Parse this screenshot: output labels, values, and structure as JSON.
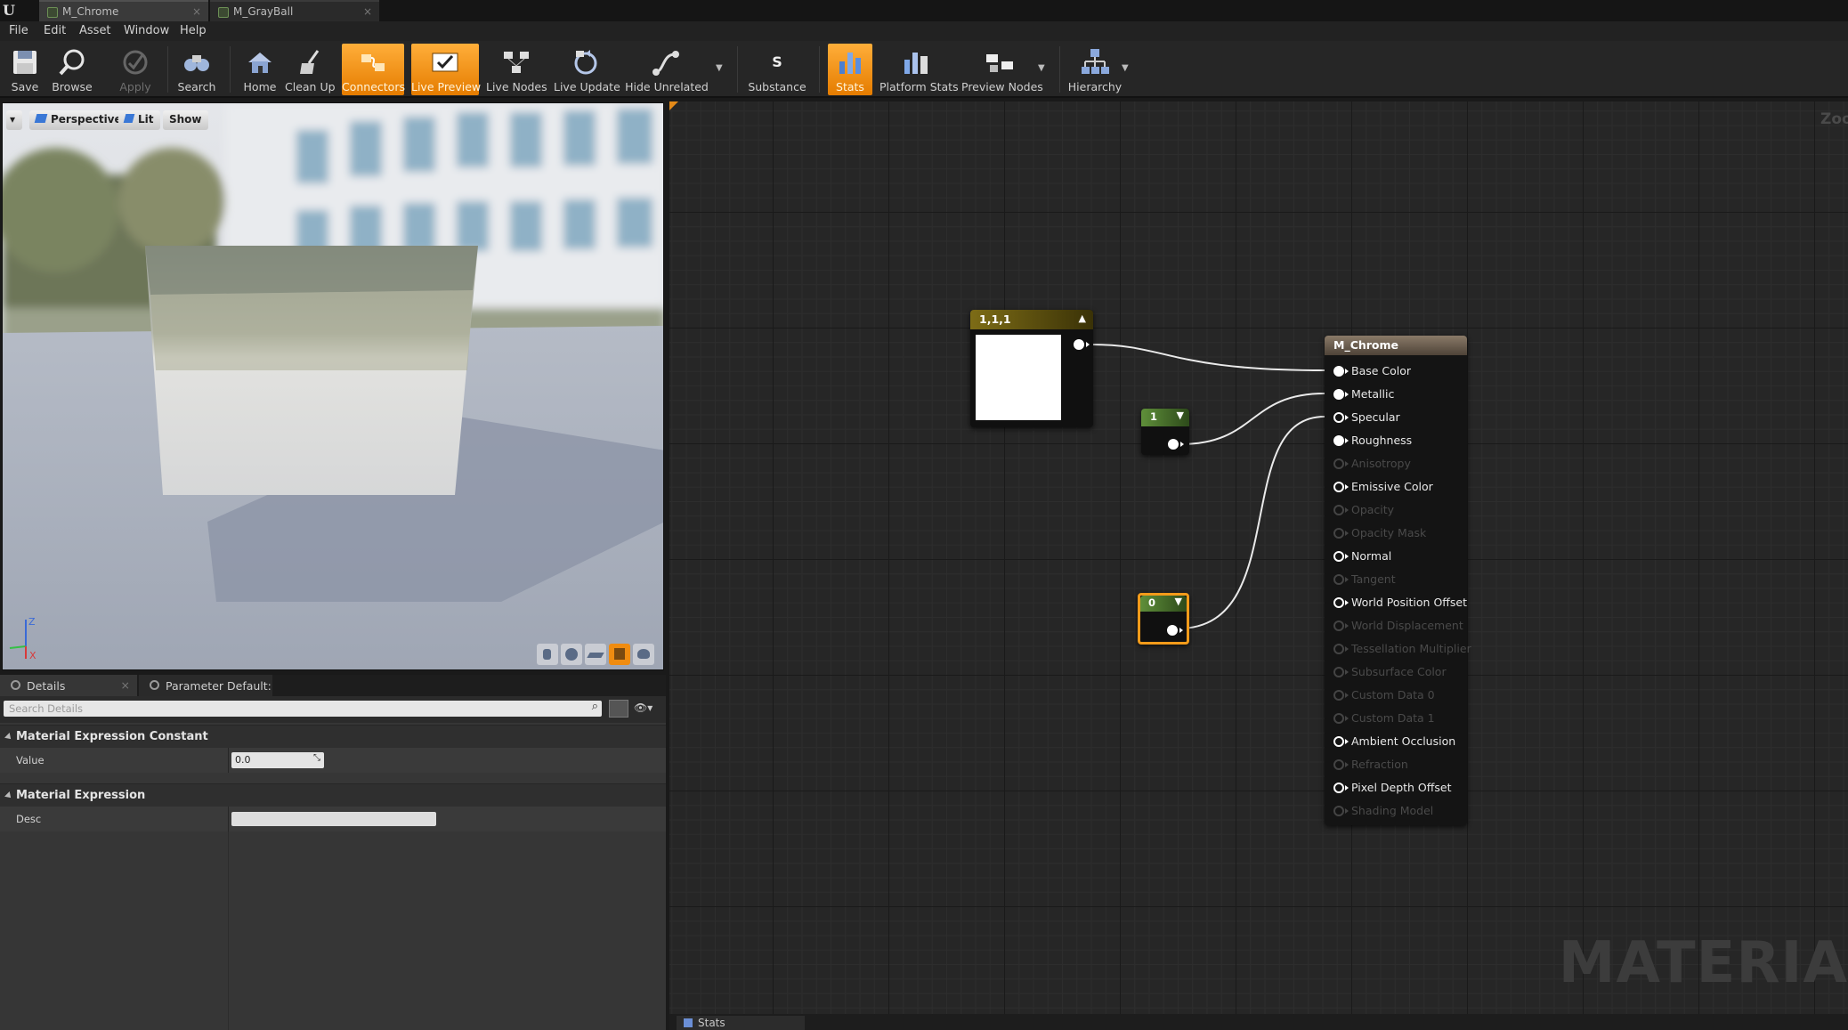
{
  "tabs": [
    {
      "label": "M_Chrome",
      "active": true
    },
    {
      "label": "M_GrayBall",
      "active": false
    }
  ],
  "menu": [
    "File",
    "Edit",
    "Asset",
    "Window",
    "Help"
  ],
  "toolbar": {
    "buttons": [
      {
        "label": "Save",
        "icon": "save-icon",
        "state": "normal"
      },
      {
        "label": "Browse",
        "icon": "browse-icon",
        "state": "normal"
      },
      {
        "label": "Apply",
        "icon": "apply-icon",
        "state": "disabled"
      },
      {
        "label": "Search",
        "icon": "search-icon",
        "state": "normal"
      },
      {
        "label": "Home",
        "icon": "home-icon",
        "state": "normal"
      },
      {
        "label": "Clean Up",
        "icon": "clean-up-icon",
        "state": "normal"
      },
      {
        "label": "Connectors",
        "icon": "connectors-icon",
        "state": "active"
      },
      {
        "label": "Live Preview",
        "icon": "live-preview-icon",
        "state": "active"
      },
      {
        "label": "Live Nodes",
        "icon": "live-nodes-icon",
        "state": "normal"
      },
      {
        "label": "Live Update",
        "icon": "live-update-icon",
        "state": "normal"
      },
      {
        "label": "Hide Unrelated",
        "icon": "hide-unrelated-icon",
        "state": "normal"
      },
      {
        "label": "Substance",
        "icon": "substance-icon",
        "state": "normal"
      },
      {
        "label": "Stats",
        "icon": "stats-icon",
        "state": "active"
      },
      {
        "label": "Platform Stats",
        "icon": "platform-stats-icon",
        "state": "normal"
      },
      {
        "label": "Preview Nodes",
        "icon": "preview-nodes-icon",
        "state": "normal"
      },
      {
        "label": "Hierarchy",
        "icon": "hierarchy-icon",
        "state": "normal"
      }
    ],
    "accent": "#f08c10"
  },
  "viewport": {
    "perspective": "Perspective",
    "lit": "Lit",
    "show": "Show",
    "axis_z": "Z",
    "axis_x": "X"
  },
  "details": {
    "tab_details": "Details",
    "tab_params": "Parameter Default:",
    "search_placeholder": "Search Details",
    "categories": [
      {
        "title": "Material Expression Constant",
        "props": [
          {
            "name": "Value",
            "value": "0.0"
          }
        ]
      },
      {
        "title": "Material Expression",
        "props": [
          {
            "name": "Desc",
            "value": ""
          }
        ]
      }
    ]
  },
  "graph": {
    "zoom_label": "Zoom",
    "watermark": "MATERIA",
    "vector_node": {
      "title": "1,1,1",
      "color": "#ffffff"
    },
    "const1_node": {
      "title": "1"
    },
    "const0_node": {
      "title": "0"
    },
    "result_node": {
      "title": "M_Chrome",
      "inputs": [
        {
          "label": "Base Color",
          "enabled": true,
          "connected": true
        },
        {
          "label": "Metallic",
          "enabled": true,
          "connected": true
        },
        {
          "label": "Specular",
          "enabled": true,
          "connected": false
        },
        {
          "label": "Roughness",
          "enabled": true,
          "connected": true
        },
        {
          "label": "Anisotropy",
          "enabled": false,
          "connected": false
        },
        {
          "label": "Emissive Color",
          "enabled": true,
          "connected": false
        },
        {
          "label": "Opacity",
          "enabled": false,
          "connected": false
        },
        {
          "label": "Opacity Mask",
          "enabled": false,
          "connected": false
        },
        {
          "label": "Normal",
          "enabled": true,
          "connected": false
        },
        {
          "label": "Tangent",
          "enabled": false,
          "connected": false
        },
        {
          "label": "World Position Offset",
          "enabled": true,
          "connected": false
        },
        {
          "label": "World Displacement",
          "enabled": false,
          "connected": false
        },
        {
          "label": "Tessellation Multiplier",
          "enabled": false,
          "connected": false
        },
        {
          "label": "Subsurface Color",
          "enabled": false,
          "connected": false
        },
        {
          "label": "Custom Data 0",
          "enabled": false,
          "connected": false
        },
        {
          "label": "Custom Data 1",
          "enabled": false,
          "connected": false
        },
        {
          "label": "Ambient Occlusion",
          "enabled": true,
          "connected": false
        },
        {
          "label": "Refraction",
          "enabled": false,
          "connected": false
        },
        {
          "label": "Pixel Depth Offset",
          "enabled": true,
          "connected": false
        },
        {
          "label": "Shading Model",
          "enabled": false,
          "connected": false
        }
      ]
    }
  },
  "bottom": {
    "stats_tab": "Stats"
  }
}
